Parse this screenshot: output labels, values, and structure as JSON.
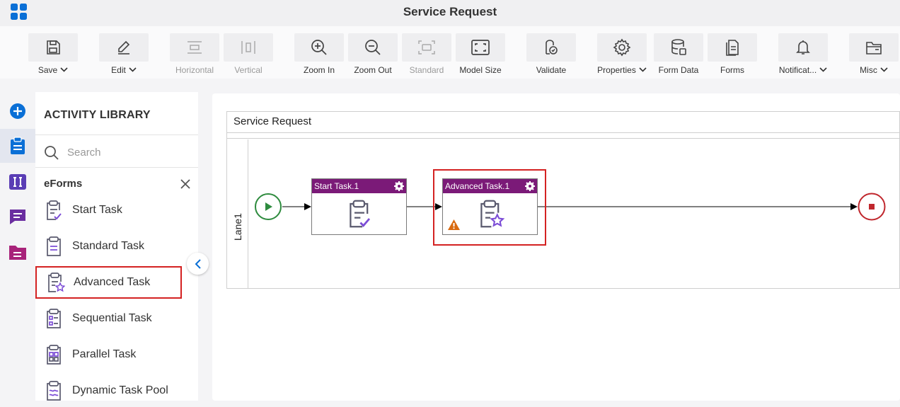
{
  "app": {
    "title": "Service Request",
    "icon": "grid-icon"
  },
  "toolbar": {
    "save": "Save",
    "edit": "Edit",
    "horizontal": "Horizontal",
    "vertical": "Vertical",
    "zoom_in": "Zoom In",
    "zoom_out": "Zoom Out",
    "standard": "Standard",
    "model_size": "Model Size",
    "validate": "Validate",
    "properties": "Properties",
    "form_data": "Form Data",
    "forms": "Forms",
    "notifications": "Notificat...",
    "misc": "Misc"
  },
  "rail": [
    "add-icon",
    "clipboard-icon",
    "text-cursor-icon",
    "chat-icon",
    "folder-icon"
  ],
  "library": {
    "title": "ACTIVITY LIBRARY",
    "search_placeholder": "Search",
    "section": "eForms",
    "items": [
      {
        "label": "Start Task",
        "icon": "start-task-icon"
      },
      {
        "label": "Standard Task",
        "icon": "standard-task-icon"
      },
      {
        "label": "Advanced Task",
        "icon": "advanced-task-icon",
        "selected": true
      },
      {
        "label": "Sequential Task",
        "icon": "sequential-task-icon"
      },
      {
        "label": "Parallel Task",
        "icon": "parallel-task-icon"
      },
      {
        "label": "Dynamic Task Pool",
        "icon": "dynamic-task-pool-icon"
      }
    ]
  },
  "canvas": {
    "pool_title": "Service Request",
    "lane": "Lane1",
    "tasks": [
      {
        "title": "Start Task.1"
      },
      {
        "title": "Advanced Task.1",
        "warning": true,
        "selected": true
      }
    ]
  },
  "colors": {
    "accent": "#0a6fd6",
    "task_header": "#7b1a78",
    "selection": "#d42222",
    "start_event": "#2e8b3e",
    "end_event": "#c0272d",
    "warning": "#d96a10"
  }
}
